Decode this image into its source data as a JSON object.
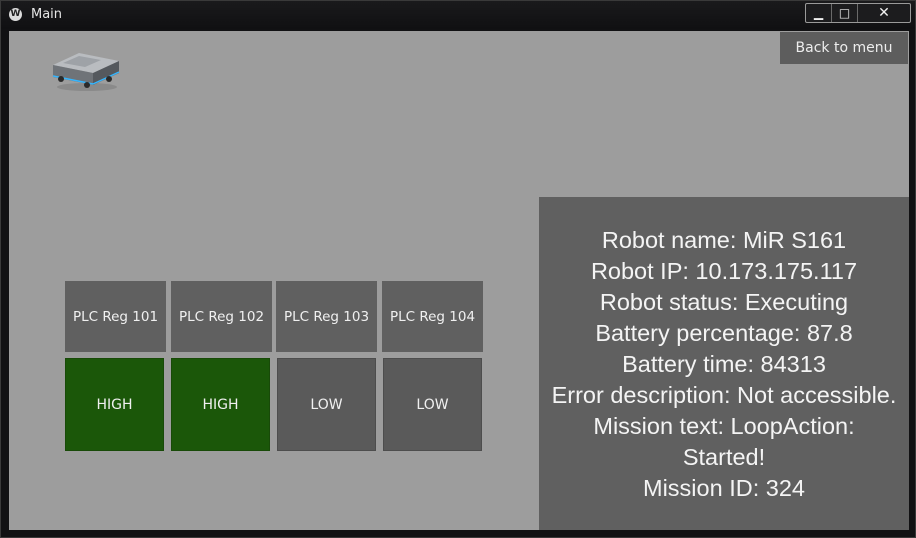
{
  "window": {
    "title": "Main",
    "app_icon_glyph": "W",
    "controls": {
      "minimize": "▁",
      "maximize": "□",
      "close": "✕"
    }
  },
  "header": {
    "back_button_label": "Back to menu"
  },
  "robot_image": {
    "icon": "mir-robot-icon"
  },
  "plc": {
    "registers": [
      {
        "label": "PLC Reg 101",
        "value": "HIGH"
      },
      {
        "label": "PLC Reg 102",
        "value": "HIGH"
      },
      {
        "label": "PLC Reg 103",
        "value": "LOW"
      },
      {
        "label": "PLC Reg 104",
        "value": "LOW"
      }
    ]
  },
  "info": {
    "robot_name": "Robot name: MiR S161",
    "robot_ip": "Robot IP: 10.173.175.117",
    "robot_status": "Robot status: Executing",
    "battery_percentage": "Battery percentage: 87.8",
    "battery_time": "Battery time: 84313",
    "error_description": "Error description: Not accessible.",
    "mission_text": "Mission text: LoopAction: Started!",
    "mission_id": "Mission ID: 324"
  },
  "colors": {
    "background": "#9d9d9d",
    "panel": "#606060",
    "high": "#1b5709",
    "low": "#5a5a5a"
  }
}
